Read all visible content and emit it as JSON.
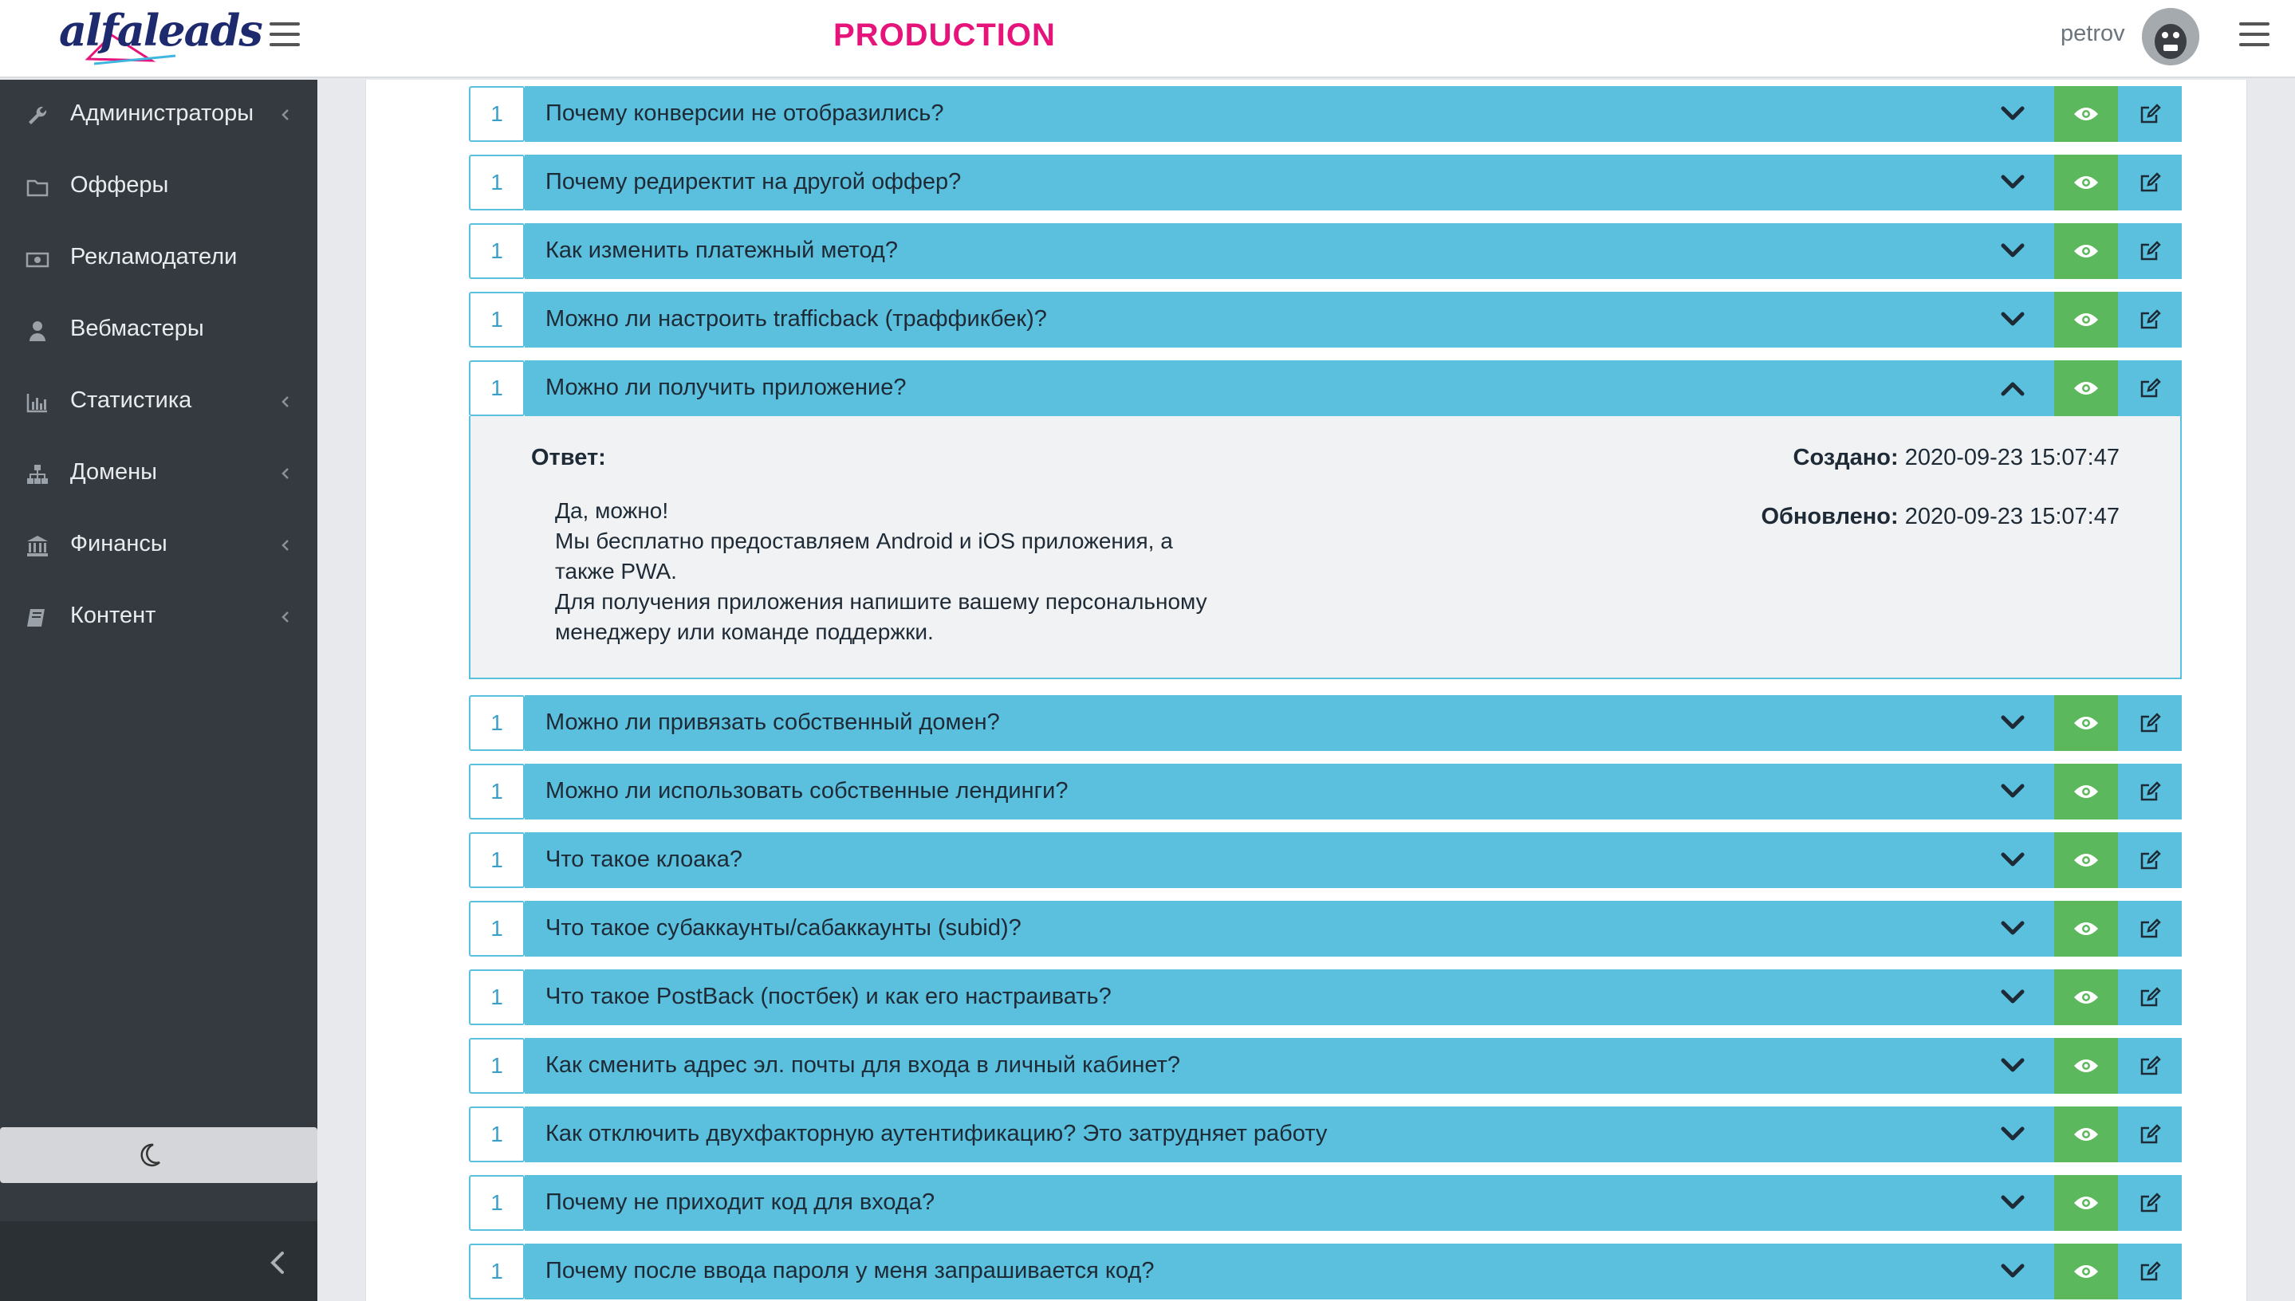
{
  "header": {
    "logo_text": "alfaleads",
    "environment": "PRODUCTION",
    "username": "petrov",
    "accent_color": "#e6137a"
  },
  "sidebar": {
    "items": [
      {
        "label": "Администраторы",
        "icon": "wrench-icon",
        "has_submenu": true
      },
      {
        "label": "Офферы",
        "icon": "folder-icon",
        "has_submenu": false
      },
      {
        "label": "Рекламодатели",
        "icon": "money-icon",
        "has_submenu": false
      },
      {
        "label": "Вебмастеры",
        "icon": "user-icon",
        "has_submenu": false
      },
      {
        "label": "Статистика",
        "icon": "bar-chart-icon",
        "has_submenu": true
      },
      {
        "label": "Домены",
        "icon": "sitemap-icon",
        "has_submenu": true
      },
      {
        "label": "Финансы",
        "icon": "bank-icon",
        "has_submenu": true
      },
      {
        "label": "Контент",
        "icon": "book-icon",
        "has_submenu": true
      }
    ],
    "theme_toggle_icon": "moon-icon",
    "collapse_icon": "chevron-left-icon"
  },
  "faq": {
    "items": [
      {
        "num": "1",
        "question": "Почему конверсии не отобразились?",
        "expanded": false
      },
      {
        "num": "1",
        "question": "Почему редиректит на другой оффер?",
        "expanded": false
      },
      {
        "num": "1",
        "question": "Как изменить платежный метод?",
        "expanded": false
      },
      {
        "num": "1",
        "question": "Можно ли настроить trafficback (траффикбек)?",
        "expanded": false
      },
      {
        "num": "1",
        "question": "Можно ли получить приложение?",
        "expanded": true
      },
      {
        "num": "1",
        "question": "Можно ли привязать собственный домен?",
        "expanded": false
      },
      {
        "num": "1",
        "question": "Можно ли использовать собственные лендинги?",
        "expanded": false
      },
      {
        "num": "1",
        "question": "Что такое клоака?",
        "expanded": false
      },
      {
        "num": "1",
        "question": "Что такое субаккаунты/сабаккаунты (subid)?",
        "expanded": false
      },
      {
        "num": "1",
        "question": "Что такое PostBack (постбек) и как его настраивать?",
        "expanded": false
      },
      {
        "num": "1",
        "question": "Как сменить адрес эл. почты для входа в личный кабинет?",
        "expanded": false
      },
      {
        "num": "1",
        "question": "Как отключить двухфакторную аутентификацию? Это затрудняет работу",
        "expanded": false
      },
      {
        "num": "1",
        "question": "Почему не приходит код для входа?",
        "expanded": false
      },
      {
        "num": "1",
        "question": "Почему после ввода пароля у меня запрашивается код?",
        "expanded": false
      }
    ],
    "expanded_answer": {
      "answer_label": "Ответ:",
      "answer_lines": [
        "Да, можно!",
        "Мы бесплатно предоставляем Android и iOS приложения, а",
        "также PWA.",
        "Для получения приложения напишите вашему персональному",
        "менеджеру или команде поддержки."
      ],
      "created_label": "Создано:",
      "created_value": "2020-09-23 15:07:47",
      "updated_label": "Обновлено:",
      "updated_value": "2020-09-23 15:07:47"
    },
    "colors": {
      "bar": "#5bc0de",
      "view_button": "#5cb85c"
    }
  }
}
